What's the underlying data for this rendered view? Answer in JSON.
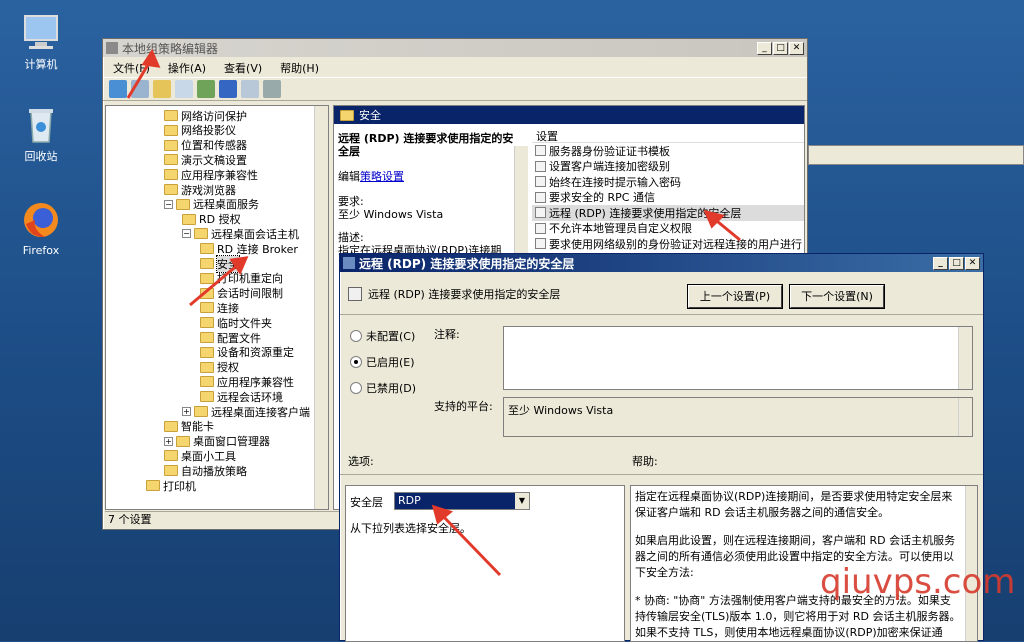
{
  "desktop": {
    "icons": [
      {
        "label": "计算机"
      },
      {
        "label": "回收站"
      },
      {
        "label": "Firefox"
      }
    ]
  },
  "main": {
    "title": "本地组策略编辑器",
    "menu": [
      "文件(F)",
      "操作(A)",
      "查看(V)",
      "帮助(H)"
    ],
    "tree": [
      {
        "label": "网络访问保护",
        "lvl": 4,
        "exp": ""
      },
      {
        "label": "网络投影仪",
        "lvl": 4,
        "exp": ""
      },
      {
        "label": "位置和传感器",
        "lvl": 4,
        "exp": ""
      },
      {
        "label": "演示文稿设置",
        "lvl": 4,
        "exp": ""
      },
      {
        "label": "应用程序兼容性",
        "lvl": 4,
        "exp": ""
      },
      {
        "label": "游戏浏览器",
        "lvl": 4,
        "exp": ""
      },
      {
        "label": "远程桌面服务",
        "lvl": 4,
        "exp": "⊟"
      },
      {
        "label": "RD 授权",
        "lvl": 5,
        "exp": ""
      },
      {
        "label": "远程桌面会话主机",
        "lvl": 5,
        "exp": "⊟"
      },
      {
        "label": "RD 连接 Broker",
        "lvl": 6,
        "exp": ""
      },
      {
        "label": "安全",
        "lvl": 6,
        "exp": "",
        "sel": true
      },
      {
        "label": "打印机重定向",
        "lvl": 6,
        "exp": ""
      },
      {
        "label": "会话时间限制",
        "lvl": 6,
        "exp": ""
      },
      {
        "label": "连接",
        "lvl": 6,
        "exp": ""
      },
      {
        "label": "临时文件夹",
        "lvl": 6,
        "exp": ""
      },
      {
        "label": "配置文件",
        "lvl": 6,
        "exp": ""
      },
      {
        "label": "设备和资源重定",
        "lvl": 6,
        "exp": ""
      },
      {
        "label": "授权",
        "lvl": 6,
        "exp": ""
      },
      {
        "label": "应用程序兼容性",
        "lvl": 6,
        "exp": ""
      },
      {
        "label": "远程会话环境",
        "lvl": 6,
        "exp": ""
      },
      {
        "label": "远程桌面连接客户端",
        "lvl": 5,
        "exp": "⊞"
      },
      {
        "label": "智能卡",
        "lvl": 4,
        "exp": ""
      },
      {
        "label": "桌面窗口管理器",
        "lvl": 4,
        "exp": "⊞"
      },
      {
        "label": "桌面小工具",
        "lvl": 4,
        "exp": ""
      },
      {
        "label": "自动播放策略",
        "lvl": 4,
        "exp": ""
      },
      {
        "label": "打印机",
        "lvl": 3,
        "exp": ""
      }
    ],
    "status": "7 个设置",
    "detail": {
      "header": "安全",
      "policy_title": "远程 (RDP) 连接要求使用指定的安全层",
      "edit_prefix": "编辑",
      "edit_link": "策略设置",
      "req_label": "要求:",
      "req_value": "至少 Windows Vista",
      "desc_label": "描述:",
      "desc_value": "指定在远程桌面协议(RDP)连接期"
    },
    "settings_header": "设置",
    "settings": [
      "服务器身份验证证书模板",
      "设置客户端连接加密级别",
      "始终在连接时提示输入密码",
      "要求安全的 RPC 通信",
      "远程 (RDP) 连接要求使用指定的安全层",
      "不允许本地管理员自定义权限",
      "要求使用网络级别的身份验证对远程连接的用户进行"
    ]
  },
  "dialog": {
    "title": "远程 (RDP) 连接要求使用指定的安全层",
    "policy_name": "远程 (RDP) 连接要求使用指定的安全层",
    "prev": "上一个设置(P)",
    "next": "下一个设置(N)",
    "radios": [
      "未配置(C)",
      "已启用(E)",
      "已禁用(D)"
    ],
    "comment_label": "注释:",
    "platform_label": "支持的平台:",
    "platform_value": "至少 Windows Vista",
    "options_label": "选项:",
    "help_label": "帮助:",
    "sec_label": "安全层",
    "sec_value": "RDP",
    "sec_hint": "从下拉列表选择安全层。",
    "help_text": [
      "指定在远程桌面协议(RDP)连接期间，是否要求使用特定安全层来保证客户端和 RD 会话主机服务器之间的通信安全。",
      "如果启用此设置，则在远程连接期间，客户端和 RD 会话主机服务器之间的所有通信必须使用此设置中指定的安全方法。可以使用以下安全方法:",
      "* 协商: \"协商\" 方法强制使用客户端支持的最安全的方法。如果支持传输层安全(TLS)版本 1.0，则它将用于对 RD 会话主机服务器。如果不支持 TLS，则使用本地远程桌面协议(RDP)加密来保证通"
    ]
  },
  "watermark": "qiuvps.com"
}
